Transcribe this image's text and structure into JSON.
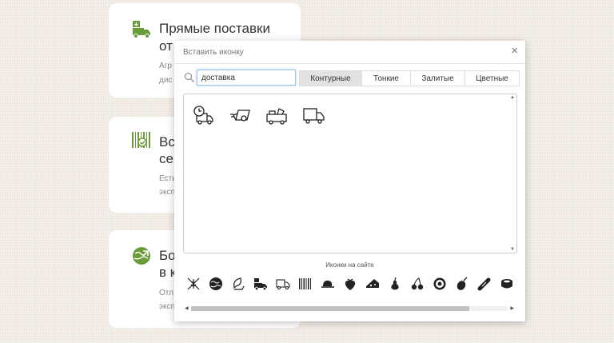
{
  "cards": [
    {
      "title_line1": "Прямые поставки",
      "title_line2": "от",
      "text_line1": "Агр",
      "text_line2": "дис"
    },
    {
      "title_line1": "Вс",
      "title_line2": "сер",
      "text_line1": "Есть",
      "text_line2": "эксп"
    },
    {
      "title_line1": "Бо",
      "title_line2": "в к",
      "text_line1": "Отл",
      "text_line2": "эксп"
    }
  ],
  "colors": {
    "accent": "#6a9c3a",
    "tab_active": "#e2e2e2"
  },
  "dialog": {
    "title": "Вставить иконку",
    "close_label": "×",
    "search": {
      "value": "доставка",
      "icon": "search-icon"
    },
    "tabs": [
      {
        "label": "Контурные",
        "active": true
      },
      {
        "label": "Тонкие",
        "active": false
      },
      {
        "label": "Залитые",
        "active": false
      },
      {
        "label": "Цветные",
        "active": false
      }
    ],
    "results": [
      "delivery-time-icon",
      "delivery-van-icon",
      "food-truck-icon",
      "truck-icon"
    ],
    "site_icons_label": "Иконки на сайте",
    "site_icons": [
      "no-wheat-icon",
      "globe-icon",
      "leaf-hand-icon",
      "delivery-truck-icon",
      "truck-icon",
      "barcode-icon",
      "hat-icon",
      "strawberry-icon",
      "cheese-icon",
      "pear-icon",
      "cherry-icon",
      "donut-icon",
      "olive-icon",
      "sausage-icon",
      "can-icon"
    ]
  }
}
